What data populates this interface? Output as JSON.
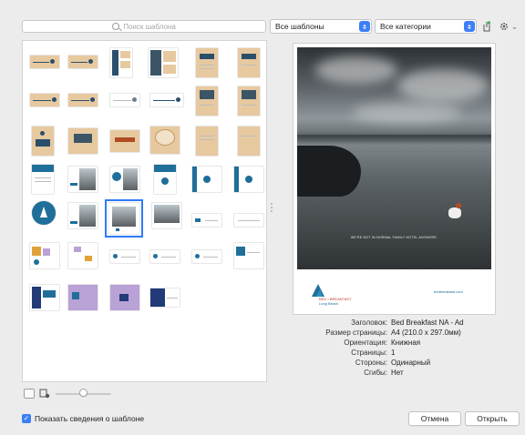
{
  "search": {
    "placeholder": "Поиск шаблона"
  },
  "filters": {
    "templates_selected": "Все шаблоны",
    "categories_selected": "Все категории"
  },
  "toolbar": {
    "share_icon": "share-icon",
    "gear_icon": "gear-icon",
    "chevron": "⌄"
  },
  "preview": {
    "photo_caption": "WE'RE NOT IN NORMAL FAMILY HOTEL ANYMORE.",
    "footer_brand_line1": "BED • BREAKFAST",
    "footer_brand_line2": "Long Beach",
    "footer_web": "bedbreakfast.com"
  },
  "info": {
    "rows": [
      {
        "key": "Заголовок:",
        "value": "Bed  Breakfast NA - Ad"
      },
      {
        "key": "Размер страницы:",
        "value": "A4 (210.0 x 297.0мм)"
      },
      {
        "key": "Ориентация:",
        "value": "Книжная"
      },
      {
        "key": "Страницы:",
        "value": "1"
      },
      {
        "key": "Стороны:",
        "value": "Одинарный"
      },
      {
        "key": "Сгибы:",
        "value": "Нет"
      }
    ]
  },
  "footer": {
    "show_info_label": "Показать сведения о шаблоне",
    "show_info_checked": true,
    "cancel_label": "Отмена",
    "open_label": "Открыть"
  },
  "zoom": {
    "thumbnail_size_fraction": 0.42
  },
  "colors": {
    "accent": "#3d7ff5",
    "brand": "#1f6f9a"
  }
}
